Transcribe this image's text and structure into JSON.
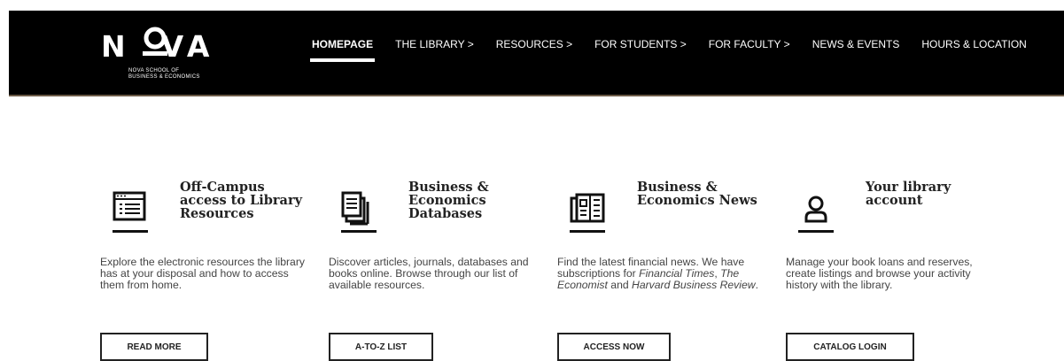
{
  "logo": {
    "word": "N VA",
    "subtitle_line1": "NOVA SCHOOL OF",
    "subtitle_line2": "BUSINESS & ECONOMICS"
  },
  "nav": {
    "items": [
      {
        "label": "HOMEPAGE",
        "active": true
      },
      {
        "label": "THE LIBRARY >"
      },
      {
        "label": "RESOURCES >"
      },
      {
        "label": "FOR STUDENTS >"
      },
      {
        "label": "FOR FACULTY >"
      },
      {
        "label": "NEWS & EVENTS"
      },
      {
        "label": "HOURS & LOCATION"
      }
    ]
  },
  "cards": [
    {
      "icon": "laptop-list-icon",
      "title": "Off-Campus access to Library Resources",
      "description": "Explore the electronic resources the library has at your disposal and how to access them from home.",
      "button": "READ MORE"
    },
    {
      "icon": "documents-icon",
      "title": "Business & Economics Databases",
      "description": "Discover articles, journals, databases and books online. Browse through our list of available resources.",
      "button": "A-TO-Z LIST"
    },
    {
      "icon": "newspaper-icon",
      "title": "Business & Economics News",
      "description_prefix": "Find  the latest financial news. We have subscriptions for ",
      "desc_ft": "Financial Times",
      "desc_sep1": ", ",
      "desc_econ": "The Economist",
      "desc_and": " and ",
      "desc_hbr": "Harvard Business Review",
      "desc_end": ".",
      "button": "ACCESS NOW"
    },
    {
      "icon": "user-account-icon",
      "title": "Your library account",
      "description": "Manage your book loans and reserves, create listings and browse your activity history with the library.",
      "button": "CATALOG LOGIN"
    }
  ]
}
